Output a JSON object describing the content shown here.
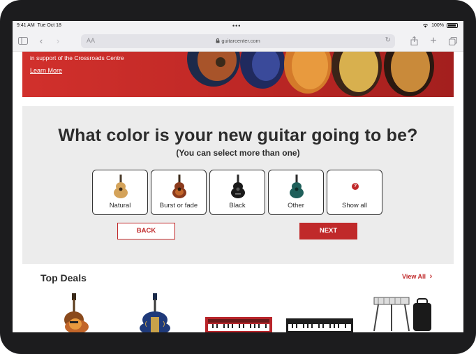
{
  "status_bar": {
    "time": "9:41 AM",
    "date": "Tue Oct 18",
    "battery": "100%"
  },
  "browser": {
    "reader_label": "AA",
    "url": "guitarcenter.com"
  },
  "banner": {
    "text": "in support of the Crossroads Centre",
    "link": "Learn More"
  },
  "quiz": {
    "title": "What color is your new guitar going to be?",
    "subtitle": "(You can select more than one)",
    "options": [
      {
        "label": "Natural",
        "color": "#d4a35a"
      },
      {
        "label": "Burst or fade",
        "color": "#8a3a1c"
      },
      {
        "label": "Black",
        "color": "#1a1a1a"
      },
      {
        "label": "Other",
        "color": "#1f5f5a"
      },
      {
        "label": "Show all",
        "icon": "question-icon"
      }
    ],
    "back_label": "BACK",
    "next_label": "NEXT"
  },
  "deals": {
    "title": "Top Deals",
    "view_all": "View All"
  },
  "colors": {
    "brand_red": "#c0292a",
    "quiz_bg": "#ececec"
  }
}
